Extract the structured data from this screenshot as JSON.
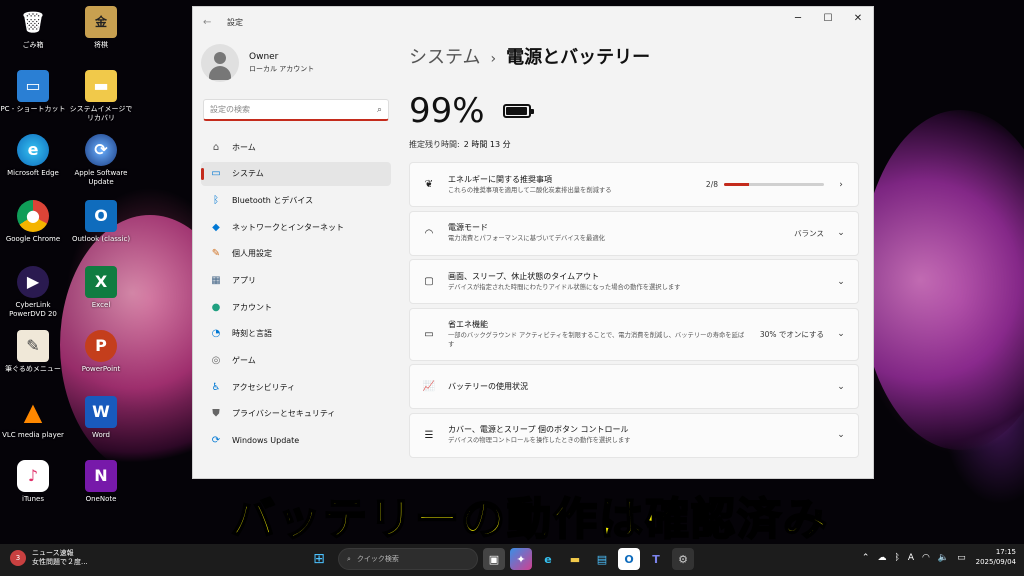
{
  "desktop": {
    "icons": [
      {
        "label": "ごみ箱",
        "icon": "recycle-bin-icon"
      },
      {
        "label": "将棋",
        "icon": "shogi-icon"
      },
      {
        "label": "PC - ショートカット",
        "icon": "pc-icon"
      },
      {
        "label": "システムイメージでリカバリ",
        "icon": "folder-icon"
      },
      {
        "label": "Microsoft Edge",
        "icon": "edge-icon"
      },
      {
        "label": "Apple Software Update",
        "icon": "apple-update-icon"
      },
      {
        "label": "Google Chrome",
        "icon": "chrome-icon"
      },
      {
        "label": "Outlook (classic)",
        "icon": "outlook-icon"
      },
      {
        "label": "CyberLink PowerDVD 20",
        "icon": "powerdvd-icon"
      },
      {
        "label": "Excel",
        "icon": "excel-icon"
      },
      {
        "label": "筆ぐるめメニュー",
        "icon": "fudegurume-icon"
      },
      {
        "label": "PowerPoint",
        "icon": "powerpoint-icon"
      },
      {
        "label": "VLC media player",
        "icon": "vlc-icon"
      },
      {
        "label": "Word",
        "icon": "word-icon"
      },
      {
        "label": "iTunes",
        "icon": "itunes-icon"
      },
      {
        "label": "OneNote",
        "icon": "onenote-icon"
      }
    ]
  },
  "window": {
    "title": "設定",
    "controls": {
      "minimize": "─",
      "maximize": "☐",
      "close": "✕"
    }
  },
  "profile": {
    "name": "Owner",
    "account_type": "ローカル アカウント"
  },
  "search": {
    "placeholder": "設定の検索"
  },
  "nav": {
    "items": [
      {
        "label": "ホーム",
        "icon": "home-icon"
      },
      {
        "label": "システム",
        "icon": "system-icon"
      },
      {
        "label": "Bluetooth とデバイス",
        "icon": "bluetooth-icon"
      },
      {
        "label": "ネットワークとインターネット",
        "icon": "network-icon"
      },
      {
        "label": "個人用設定",
        "icon": "personalization-icon"
      },
      {
        "label": "アプリ",
        "icon": "apps-icon"
      },
      {
        "label": "アカウント",
        "icon": "accounts-icon"
      },
      {
        "label": "時刻と言語",
        "icon": "time-language-icon"
      },
      {
        "label": "ゲーム",
        "icon": "gaming-icon"
      },
      {
        "label": "アクセシビリティ",
        "icon": "accessibility-icon"
      },
      {
        "label": "プライバシーとセキュリティ",
        "icon": "privacy-icon"
      },
      {
        "label": "Windows Update",
        "icon": "windows-update-icon"
      }
    ],
    "active_index": 1
  },
  "page": {
    "breadcrumb_parent": "システム",
    "breadcrumb_sep": "›",
    "breadcrumb_current": "電源とバッテリー",
    "battery_percent": "99%",
    "battery_level": 0.99,
    "remaining_label": "推定残り時間:",
    "remaining_value": "2 時間 13 分"
  },
  "cards": [
    {
      "title": "エネルギーに関する推奨事項",
      "subtitle": "これらの推奨事項を適用して二酸化炭素排出量を削減する",
      "icon": "leaf-icon",
      "value": "2/8",
      "progress": 0.25,
      "chevron": "›"
    },
    {
      "title": "電源モード",
      "subtitle": "電力消費とパフォーマンスに基づいてデバイスを最適化",
      "icon": "power-mode-icon",
      "value": "バランス",
      "chevron": "⌄"
    },
    {
      "title": "画面、スリープ、休止状態のタイムアウト",
      "subtitle": "デバイスが指定された時間にわたりアイドル状態になった場合の動作を選択します",
      "icon": "screen-sleep-icon",
      "value": "",
      "chevron": "⌄"
    },
    {
      "title": "省エネ機能",
      "subtitle": "一部のバックグラウンド アクティビティを制限することで、電力消費を削減し、バッテリーの寿命を延ばす",
      "icon": "battery-saver-icon",
      "value": "30% でオンにする",
      "chevron": "⌄"
    },
    {
      "title": "バッテリーの使用状況",
      "subtitle": "",
      "icon": "usage-chart-icon",
      "value": "",
      "chevron": "⌄"
    },
    {
      "title": "カバー、電源とスリープ 個のボタン コントロール",
      "subtitle": "デバイスの物理コントロールを操作したときの動作を選択します",
      "icon": "button-controls-icon",
      "value": "",
      "chevron": "⌄"
    }
  ],
  "caption": "バッテリーの動作は確認済み",
  "taskbar": {
    "news_badge": "3",
    "news_title": "ニュース速報",
    "news_text": "女性問題で２度...",
    "search_placeholder": "クイック検索",
    "tray_ime": "A",
    "time": "17:15",
    "date": "2025/09/04"
  }
}
